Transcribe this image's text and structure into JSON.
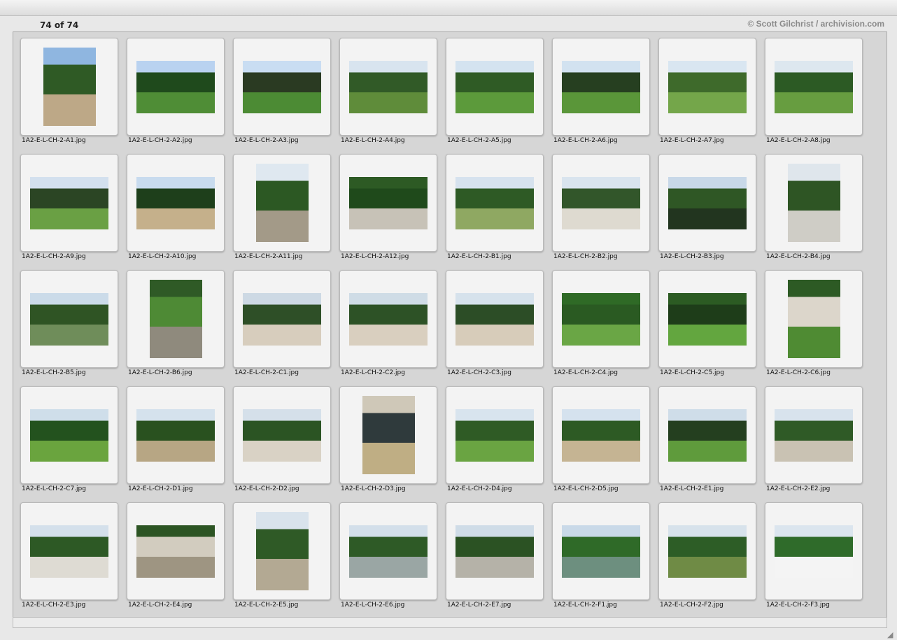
{
  "window": {
    "counter": "74 of 74",
    "copyright": "© Scott Gilchrist / archivision.com"
  },
  "thumbnails": [
    {
      "name": "1A2-E-L-CH-2-A1.jpg",
      "orientation": "portrait",
      "colors": [
        "#8fb6e0",
        "#2f5a25",
        "#bda887"
      ]
    },
    {
      "name": "1A2-E-L-CH-2-A2.jpg",
      "orientation": "landscape",
      "colors": [
        "#b9d2f0",
        "#1f4a1c",
        "#4f8d36"
      ]
    },
    {
      "name": "1A2-E-L-CH-2-A3.jpg",
      "orientation": "landscape",
      "colors": [
        "#c9ddf2",
        "#2a3a22",
        "#4c8b34"
      ]
    },
    {
      "name": "1A2-E-L-CH-2-A4.jpg",
      "orientation": "landscape",
      "colors": [
        "#d8e4ef",
        "#315a27",
        "#5f8c3a"
      ]
    },
    {
      "name": "1A2-E-L-CH-2-A5.jpg",
      "orientation": "landscape",
      "colors": [
        "#d4e3f0",
        "#2f5b25",
        "#5c9a3b"
      ]
    },
    {
      "name": "1A2-E-L-CH-2-A6.jpg",
      "orientation": "landscape",
      "colors": [
        "#d2e2f0",
        "#263f20",
        "#5a9639"
      ]
    },
    {
      "name": "1A2-E-L-CH-2-A7.jpg",
      "orientation": "landscape",
      "colors": [
        "#d9e6f1",
        "#3e6a2b",
        "#74a64a"
      ]
    },
    {
      "name": "1A2-E-L-CH-2-A8.jpg",
      "orientation": "landscape",
      "colors": [
        "#dde7ef",
        "#2c5a24",
        "#679d40"
      ]
    },
    {
      "name": "1A2-E-L-CH-2-A9.jpg",
      "orientation": "landscape",
      "colors": [
        "#d3e0ee",
        "#2b4524",
        "#6aa044"
      ]
    },
    {
      "name": "1A2-E-L-CH-2-A10.jpg",
      "orientation": "landscape",
      "colors": [
        "#c8dbee",
        "#1e3f1b",
        "#c5b08b"
      ]
    },
    {
      "name": "1A2-E-L-CH-2-A11.jpg",
      "orientation": "portrait",
      "colors": [
        "#dfe8f0",
        "#2c5823",
        "#a39a88"
      ]
    },
    {
      "name": "1A2-E-L-CH-2-A12.jpg",
      "orientation": "landscape",
      "colors": [
        "#2d5a24",
        "#1f4a1b",
        "#c7c2b7"
      ]
    },
    {
      "name": "1A2-E-L-CH-2-B1.jpg",
      "orientation": "landscape",
      "colors": [
        "#d6e2ee",
        "#2e5a25",
        "#8fa862"
      ]
    },
    {
      "name": "1A2-E-L-CH-2-B2.jpg",
      "orientation": "landscape",
      "colors": [
        "#d9e4ee",
        "#32562a",
        "#dedad0"
      ]
    },
    {
      "name": "1A2-E-L-CH-2-B3.jpg",
      "orientation": "landscape",
      "colors": [
        "#c8d8e8",
        "#2f5725",
        "#22351f"
      ]
    },
    {
      "name": "1A2-E-L-CH-2-B4.jpg",
      "orientation": "portrait",
      "colors": [
        "#dfe6ec",
        "#2e5524",
        "#cfcdc6"
      ]
    },
    {
      "name": "1A2-E-L-CH-2-B5.jpg",
      "orientation": "landscape",
      "colors": [
        "#cbdbe9",
        "#2f5424",
        "#6f8d5a"
      ]
    },
    {
      "name": "1A2-E-L-CH-2-B6.jpg",
      "orientation": "portrait",
      "colors": [
        "#2f5a26",
        "#4e8a35",
        "#8f8a7d"
      ]
    },
    {
      "name": "1A2-E-L-CH-2-C1.jpg",
      "orientation": "landscape",
      "colors": [
        "#cdd9e4",
        "#2e4f27",
        "#d7cdbd"
      ]
    },
    {
      "name": "1A2-E-L-CH-2-C2.jpg",
      "orientation": "landscape",
      "colors": [
        "#cfdce6",
        "#2d5226",
        "#d9cfbf"
      ]
    },
    {
      "name": "1A2-E-L-CH-2-C3.jpg",
      "orientation": "landscape",
      "colors": [
        "#d6e2ec",
        "#2c4d26",
        "#d7ccba"
      ]
    },
    {
      "name": "1A2-E-L-CH-2-C4.jpg",
      "orientation": "landscape",
      "colors": [
        "#2f6a26",
        "#2a5a22",
        "#6aa645"
      ]
    },
    {
      "name": "1A2-E-L-CH-2-C5.jpg",
      "orientation": "landscape",
      "colors": [
        "#2c5b23",
        "#1e3d19",
        "#63a63f"
      ]
    },
    {
      "name": "1A2-E-L-CH-2-C6.jpg",
      "orientation": "portrait",
      "colors": [
        "#2d5a24",
        "#dcd6cb",
        "#4f8b33"
      ]
    },
    {
      "name": "1A2-E-L-CH-2-C7.jpg",
      "orientation": "landscape",
      "colors": [
        "#cfdeea",
        "#23521e",
        "#6aa43e"
      ]
    },
    {
      "name": "1A2-E-L-CH-2-D1.jpg",
      "orientation": "landscape",
      "colors": [
        "#d5e2ed",
        "#29511f",
        "#b7a684"
      ]
    },
    {
      "name": "1A2-E-L-CH-2-D2.jpg",
      "orientation": "landscape",
      "colors": [
        "#d5e0ea",
        "#2b5423",
        "#d9d2c5"
      ]
    },
    {
      "name": "1A2-E-L-CH-2-D3.jpg",
      "orientation": "portrait",
      "colors": [
        "#cfc8b8",
        "#2f3a3c",
        "#bfae84"
      ]
    },
    {
      "name": "1A2-E-L-CH-2-D4.jpg",
      "orientation": "landscape",
      "colors": [
        "#d8e4ee",
        "#2f5b25",
        "#6aa442"
      ]
    },
    {
      "name": "1A2-E-L-CH-2-D5.jpg",
      "orientation": "landscape",
      "colors": [
        "#d5e2ee",
        "#2d5a24",
        "#c5b493"
      ]
    },
    {
      "name": "1A2-E-L-CH-2-E1.jpg",
      "orientation": "landscape",
      "colors": [
        "#cfdde9",
        "#243f1f",
        "#5f9b3c"
      ]
    },
    {
      "name": "1A2-E-L-CH-2-E2.jpg",
      "orientation": "landscape",
      "colors": [
        "#d8e3ed",
        "#2f5a26",
        "#c9c2b3"
      ]
    },
    {
      "name": "1A2-E-L-CH-2-E3.jpg",
      "orientation": "landscape",
      "colors": [
        "#d4e0eb",
        "#2d5925",
        "#dedbd3"
      ]
    },
    {
      "name": "1A2-E-L-CH-2-E4.jpg",
      "orientation": "landscape",
      "colors": [
        "#2c5423",
        "#d2ccbf",
        "#9e9582"
      ]
    },
    {
      "name": "1A2-E-L-CH-2-E5.jpg",
      "orientation": "portrait",
      "colors": [
        "#d9e3ec",
        "#2f5a26",
        "#b3a993"
      ]
    },
    {
      "name": "1A2-E-L-CH-2-E6.jpg",
      "orientation": "landscape",
      "colors": [
        "#d3dfea",
        "#2e5a26",
        "#9aa6a4"
      ]
    },
    {
      "name": "1A2-E-L-CH-2-E7.jpg",
      "orientation": "landscape",
      "colors": [
        "#cfdce7",
        "#2b5223",
        "#b5b2a8"
      ]
    },
    {
      "name": "1A2-E-L-CH-2-F1.jpg",
      "orientation": "landscape",
      "colors": [
        "#c9d9e8",
        "#2f6a28",
        "#6d8f7f"
      ]
    },
    {
      "name": "1A2-E-L-CH-2-F2.jpg",
      "orientation": "landscape",
      "colors": [
        "#d7e2eb",
        "#2d5d26",
        "#6f8b45"
      ]
    },
    {
      "name": "1A2-E-L-CH-2-F3.jpg",
      "orientation": "landscape",
      "colors": [
        "#dbe5ee",
        "#2f6b2a",
        "#f4f4f4"
      ]
    }
  ],
  "scrollbar": {
    "up_icon": "arrow-up-icon",
    "down_icon": "arrow-down-icon",
    "position_fraction": 0.0,
    "visible_fraction": 0.54
  }
}
